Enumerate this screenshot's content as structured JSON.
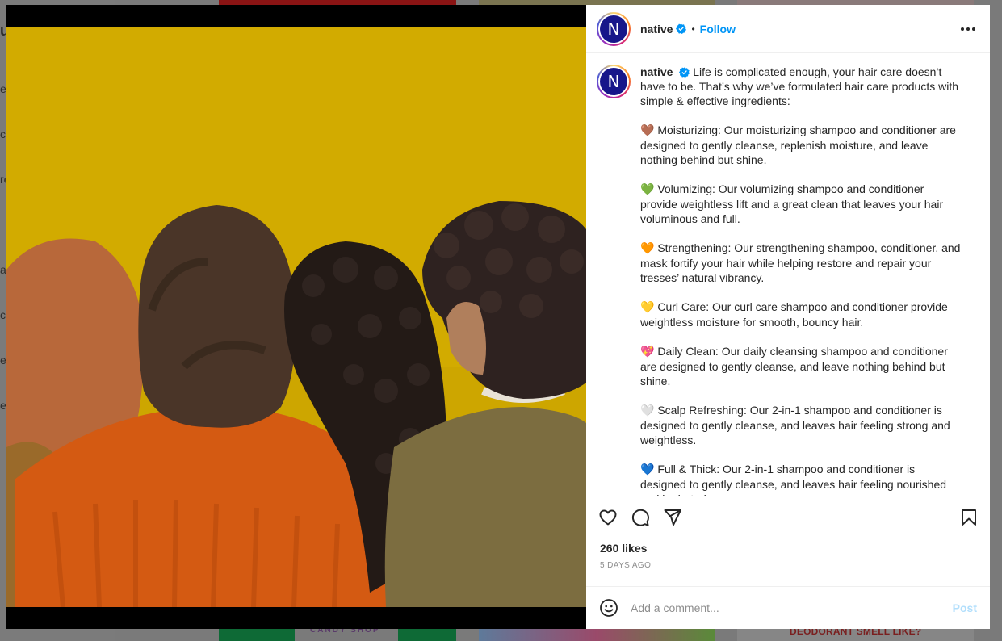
{
  "post": {
    "username": "native",
    "follow_label": "Follow",
    "separator": "•",
    "avatar_letter": "N",
    "caption": {
      "username": "native",
      "intro": "Life is complicated enough, your hair care doesn’t have to be. That’s why we’ve formulated hair care products with simple & effective ingredients:",
      "items": [
        {
          "emoji": "🤎",
          "text": "Moisturizing: Our moisturizing shampoo and conditioner are designed to gently cleanse, replenish moisture, and leave nothing behind but shine."
        },
        {
          "emoji": "💚",
          "text": "Volumizing: Our volumizing shampoo and conditioner provide weightless lift and a great clean that leaves your hair voluminous and full."
        },
        {
          "emoji": "🧡",
          "text": "Strengthening: Our strengthening shampoo, conditioner, and mask fortify your hair while helping restore and repair your tresses’ natural vibrancy."
        },
        {
          "emoji": "💛",
          "text": "Curl Care: Our curl care shampoo and conditioner provide weightless moisture for smooth, bouncy hair."
        },
        {
          "emoji": "💖",
          "text": "Daily Clean: Our daily cleansing shampoo and conditioner are designed to gently cleanse, and leave nothing behind but shine."
        },
        {
          "emoji": "🤍",
          "text": "Scalp Refreshing: Our 2-in-1 shampoo and conditioner is designed to gently cleanse, and leaves hair feeling strong and weightless."
        },
        {
          "emoji": "💙",
          "text": "Full & Thick: Our 2-in-1 shampoo and conditioner is designed to gently cleanse, and leaves hair feeling nourished and hydrated."
        }
      ]
    },
    "likes": "260 likes",
    "time_ago": "5 DAYS AGO",
    "comment": {
      "placeholder": "Add a comment...",
      "post_label": "Post"
    }
  },
  "background": {
    "left_letters": [
      "u",
      "e",
      "ch",
      "re",
      "a",
      "c",
      "e",
      "e"
    ],
    "candy_text": "CANDY SHOP",
    "bottom_right_text": "DEODORANT SMELL LIKE?"
  },
  "colors": {
    "accent": "#0095f6",
    "post_disabled": "#b2dffc",
    "avatar_bg": "#17168a",
    "photo_bg": "#c9a800"
  }
}
